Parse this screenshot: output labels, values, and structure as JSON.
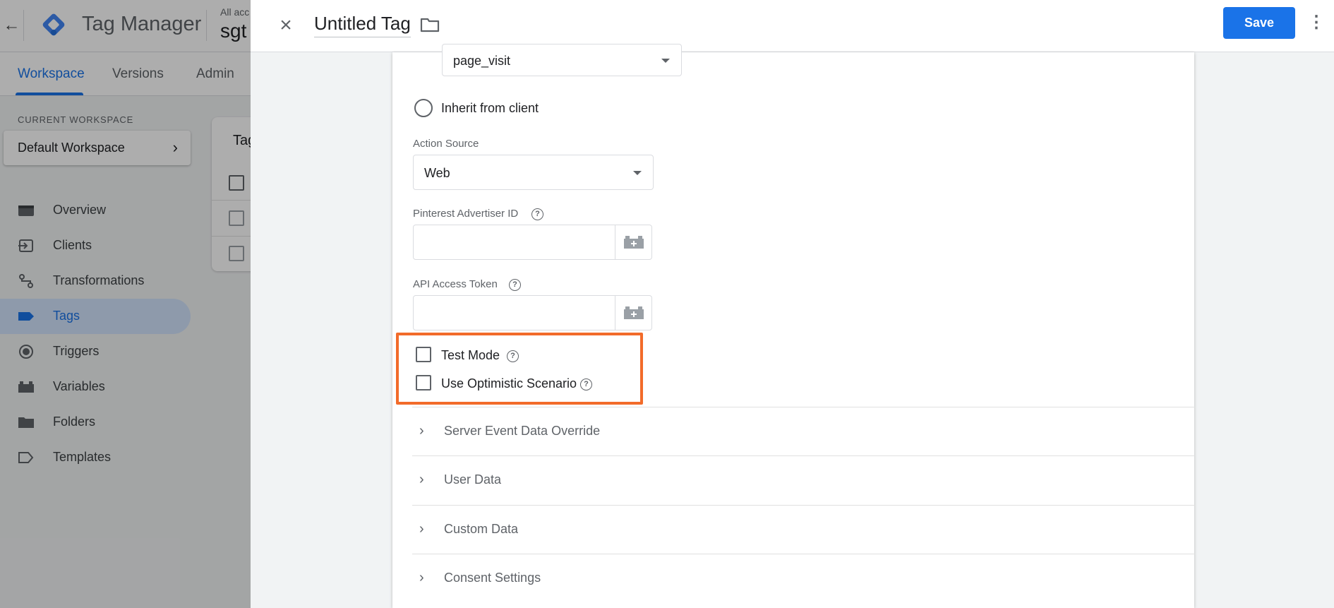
{
  "app": {
    "back_icon": "arrow-left-icon",
    "title": "Tag Manager",
    "account_label": "All acc",
    "account_name": "sgt"
  },
  "nav": {
    "tabs": [
      "Workspace",
      "Versions",
      "Admin"
    ]
  },
  "workspace": {
    "label": "CURRENT WORKSPACE",
    "name": "Default Workspace",
    "chevron": "›"
  },
  "sidebar": {
    "items": [
      {
        "label": "Overview",
        "icon": "overview-icon"
      },
      {
        "label": "Clients",
        "icon": "clients-icon"
      },
      {
        "label": "Transformations",
        "icon": "transformations-icon"
      },
      {
        "label": "Tags",
        "icon": "tag-icon"
      },
      {
        "label": "Triggers",
        "icon": "triggers-icon"
      },
      {
        "label": "Variables",
        "icon": "variables-icon"
      },
      {
        "label": "Folders",
        "icon": "folder-icon"
      },
      {
        "label": "Templates",
        "icon": "templates-icon"
      }
    ]
  },
  "tags_card": {
    "title": "Tag"
  },
  "panel": {
    "title": "Untitled Tag",
    "close": "×",
    "save_label": "Save",
    "more": "⋮"
  },
  "form": {
    "event_name_value": "page_visit",
    "inherit_label": "Inherit from client",
    "action_source_label": "Action Source",
    "action_source_value": "Web",
    "advertiser_id_label": "Pinterest Advertiser ID",
    "advertiser_id_value": "",
    "api_token_label": "API Access Token",
    "api_token_value": "",
    "test_mode_label": "Test Mode",
    "optimistic_label": "Use Optimistic Scenario",
    "help_glyph": "?",
    "accent_color": "#f26b2a"
  },
  "sections": [
    {
      "title": "Server Event Data Override",
      "chevron": "›"
    },
    {
      "title": "User Data",
      "chevron": "›"
    },
    {
      "title": "Custom Data",
      "chevron": "›"
    },
    {
      "title": "Consent Settings",
      "chevron": "›"
    }
  ]
}
